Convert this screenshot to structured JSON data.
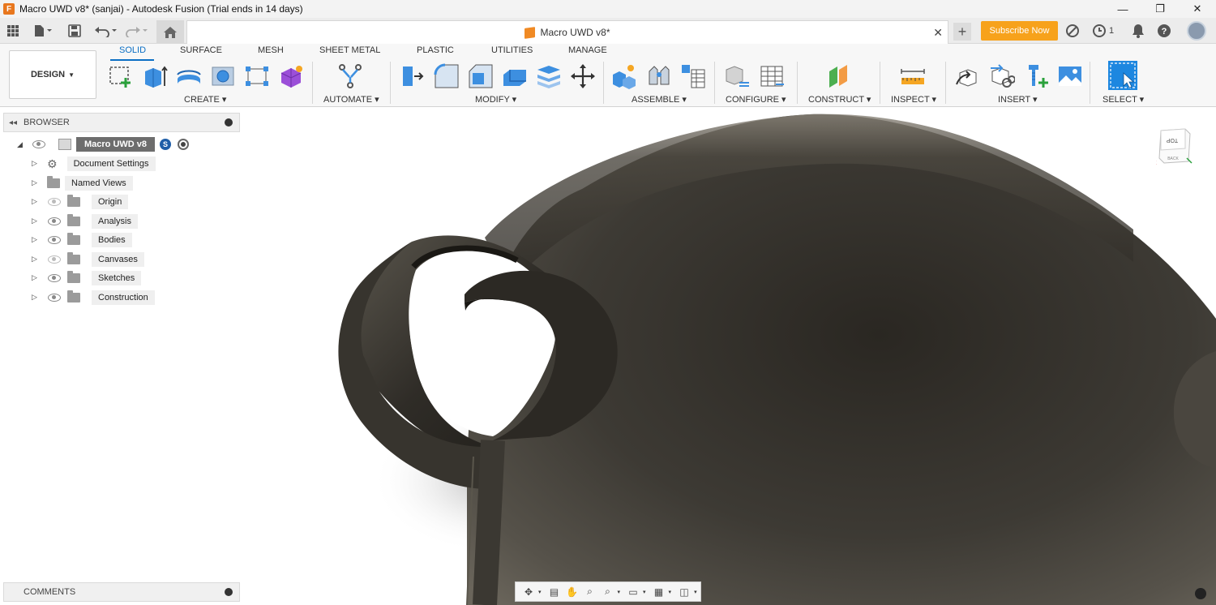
{
  "window": {
    "title": "Macro UWD v8* (sanjai) - Autodesk Fusion (Trial ends in 14 days)",
    "app_logo": "F",
    "minimize": "—",
    "maximize": "❐",
    "close": "✕"
  },
  "topbar": {
    "doc_tab_title": "Macro UWD v8*",
    "doc_tab_close": "✕",
    "new_tab": "+",
    "subscribe_label": "Subscribe Now",
    "jobs_count": "1",
    "icons": [
      "grid-icon",
      "file-icon",
      "save-icon",
      "undo-icon",
      "redo-icon",
      "home-icon",
      "offline-icon",
      "clock-icon",
      "bell-icon",
      "help-icon"
    ]
  },
  "ribbon": {
    "workspace_label": "DESIGN",
    "tabs": [
      "SOLID",
      "SURFACE",
      "MESH",
      "SHEET METAL",
      "PLASTIC",
      "UTILITIES",
      "MANAGE"
    ],
    "active_tab": "SOLID",
    "groups": [
      "CREATE",
      "AUTOMATE",
      "MODIFY",
      "ASSEMBLE",
      "CONFIGURE",
      "CONSTRUCT",
      "INSPECT",
      "INSERT",
      "SELECT"
    ],
    "accent_color": "#0b6fc4"
  },
  "browser": {
    "title": "BROWSER",
    "root_label": "Macro UWD v8",
    "items": [
      {
        "label": "Document Settings",
        "icon": "gear-icon",
        "visible": null
      },
      {
        "label": "Named Views",
        "icon": "folder-icon",
        "visible": null
      },
      {
        "label": "Origin",
        "icon": "folder-icon",
        "visible": false
      },
      {
        "label": "Analysis",
        "icon": "folder-icon",
        "visible": true
      },
      {
        "label": "Bodies",
        "icon": "folder-icon",
        "visible": true
      },
      {
        "label": "Canvases",
        "icon": "folder-icon",
        "visible": false
      },
      {
        "label": "Sketches",
        "icon": "folder-icon",
        "visible": true
      },
      {
        "label": "Construction",
        "icon": "folder-icon",
        "visible": true
      }
    ]
  },
  "comments": {
    "title": "COMMENTS"
  },
  "viewcube": {
    "face_label": "TOP",
    "side_label": "BACK",
    "axis_label": "X"
  }
}
